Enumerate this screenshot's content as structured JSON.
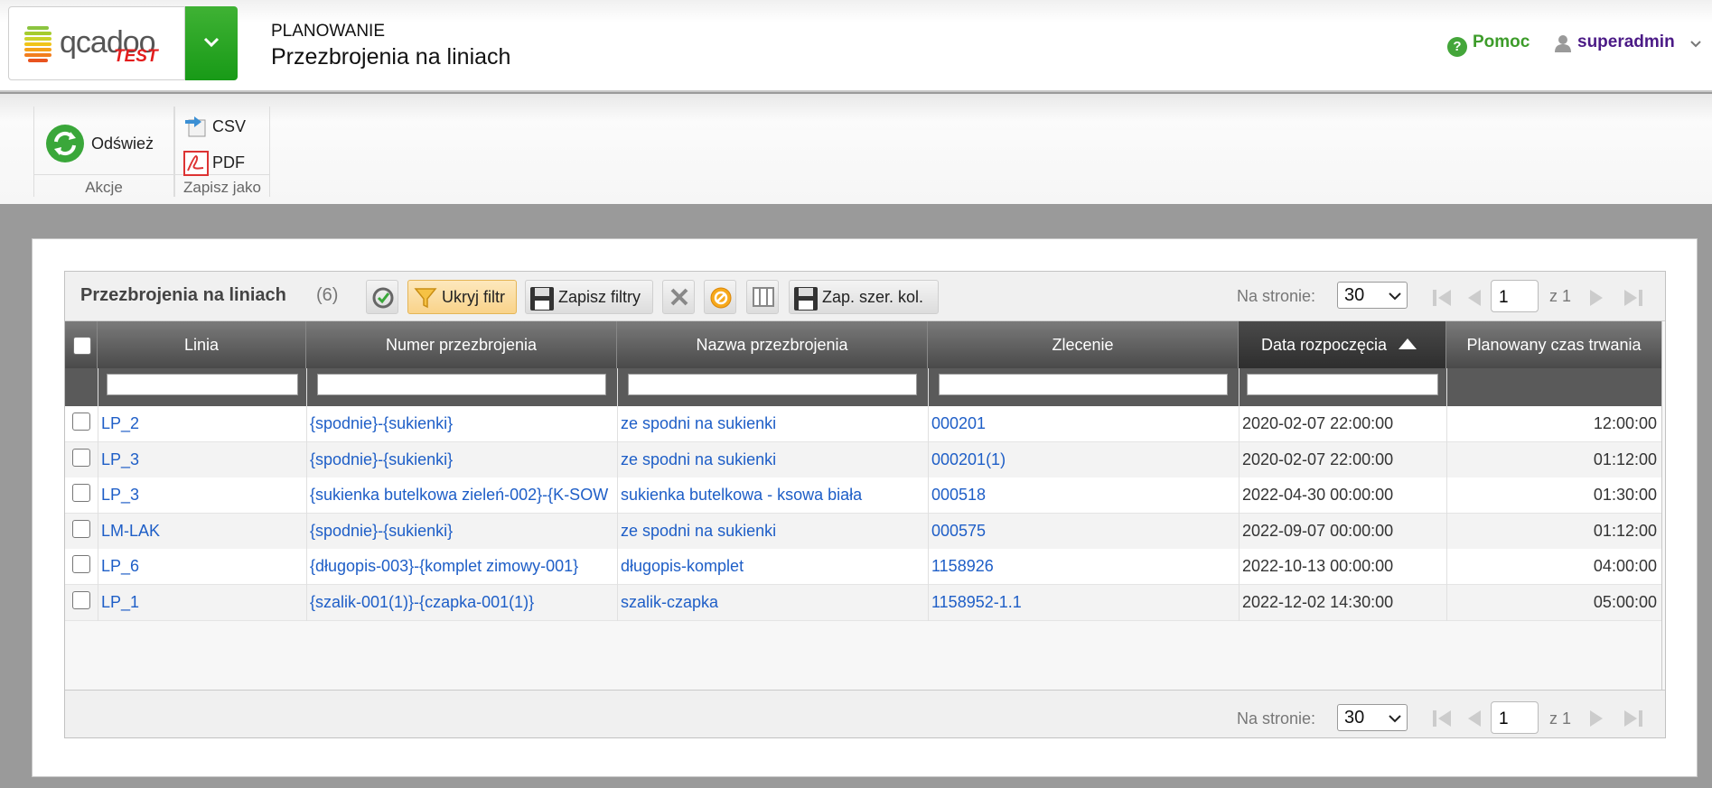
{
  "header": {
    "logo_word": "qcadoo",
    "logo_badge": "TEST",
    "section": "PLANOWANIE",
    "title": "Przezbrojenia na liniach",
    "help": "Pomoc",
    "user": "superadmin"
  },
  "ribbon": {
    "refresh": "Odśwież",
    "group_actions": "Akcje",
    "csv": "CSV",
    "pdf": "PDF",
    "group_save": "Zapisz jako"
  },
  "grid": {
    "title": "Przezbrojenia na liniach",
    "count": "(6)",
    "hide_filter": "Ukryj filtr",
    "save_filters": "Zapisz filtry",
    "save_col_widths": "Zap. szer. kol.",
    "per_page_label": "Na stronie:",
    "per_page": "30",
    "page": "1",
    "of_pages": "z 1",
    "columns": [
      "Linia",
      "Numer przezbrojenia",
      "Nazwa przezbrojenia",
      "Zlecenie",
      "Data rozpoczęcia",
      "Planowany czas trwania"
    ],
    "rows": [
      {
        "line": "LP_2",
        "number": "{spodnie}-{sukienki}",
        "name": "ze spodni na sukienki",
        "order": "000201",
        "start": "2020-02-07 22:00:00",
        "duration": "12:00:00"
      },
      {
        "line": "LP_3",
        "number": "{spodnie}-{sukienki}",
        "name": "ze spodni na sukienki",
        "order": "000201(1)",
        "start": "2020-02-07 22:00:00",
        "duration": "01:12:00"
      },
      {
        "line": "LP_3",
        "number": "{sukienka butelkowa zieleń-002}-{K-SOW",
        "name": "sukienka butelkowa - ksowa biała",
        "order": "000518",
        "start": "2022-04-30 00:00:00",
        "duration": "01:30:00"
      },
      {
        "line": "LM-LAK",
        "number": "{spodnie}-{sukienki}",
        "name": "ze spodni na sukienki",
        "order": "000575",
        "start": "2022-09-07 00:00:00",
        "duration": "01:12:00"
      },
      {
        "line": "LP_6",
        "number": "{długopis-003}-{komplet zimowy-001}",
        "name": "długopis-komplet",
        "order": "1158926",
        "start": "2022-10-13 00:00:00",
        "duration": "04:00:00"
      },
      {
        "line": "LP_1",
        "number": "{szalik-001(1)}-{czapka-001(1)}",
        "name": "szalik-czapka",
        "order": "1158952-1.1",
        "start": "2022-12-02 14:30:00",
        "duration": "05:00:00"
      }
    ]
  },
  "colors": {
    "link": "#1e5ec7",
    "brand_green": "#189a17",
    "help_green": "#3d9c2a",
    "user_purple": "#4b1a86"
  }
}
